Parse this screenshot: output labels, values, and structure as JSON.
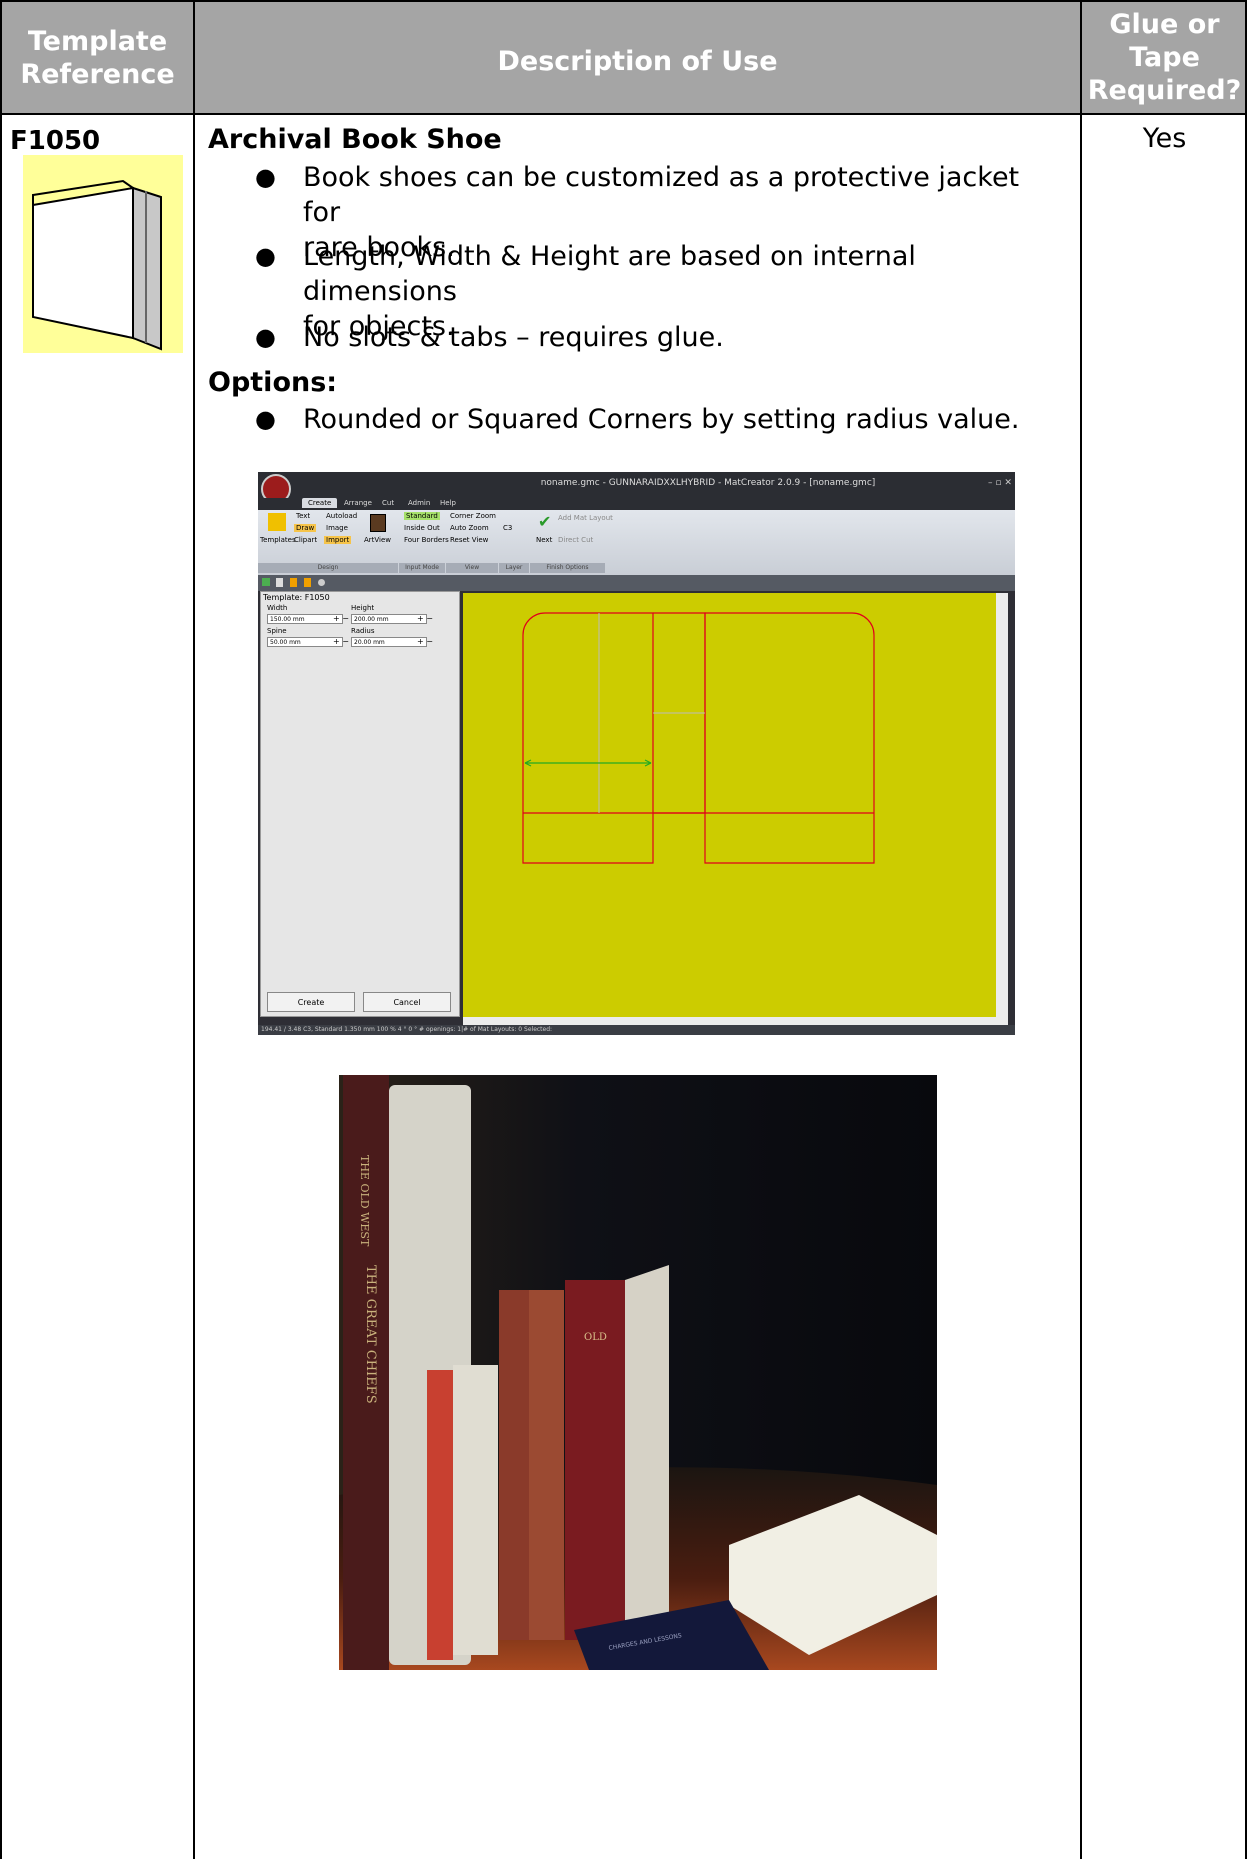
{
  "header": {
    "col1": "Template Reference",
    "col1_lines": [
      "Template",
      "Reference"
    ],
    "col2": "Description of Use",
    "col3_lines": [
      "Glue or",
      "Tape",
      "Required?"
    ]
  },
  "row": {
    "reference": "F1050",
    "glue_required": "Yes",
    "title": "Archival Book Shoe",
    "bullets": [
      [
        "Book shoes can be customized as a protective jacket for",
        "rare books."
      ],
      [
        "Length, Width & Height are based on internal dimensions",
        "for objects."
      ],
      [
        "No slots & tabs – requires glue."
      ]
    ],
    "options_label": "Options:",
    "options": [
      "Rounded or Squared Corners by setting radius value."
    ]
  },
  "screenshot": {
    "title": "noname.gmc - GUNNARAIDXXLHYBRID - MatCreator 2.0.9 - [noname.gmc]",
    "tabs": [
      "Create",
      "Arrange",
      "Cut",
      "Admin",
      "Help"
    ],
    "ribbon": {
      "templates": "Templates",
      "text": "Text",
      "autoload": "Autoload",
      "draw": "Draw",
      "image": "Image",
      "clipart": "Clipart",
      "import": "Import",
      "artview": "ArtView",
      "standard": "Standard",
      "inside_out": "Inside Out",
      "four_borders": "Four Borders",
      "corner_zoom": "Corner Zoom",
      "auto_zoom": "Auto Zoom",
      "reset_view": "Reset View",
      "c3": "C3",
      "next": "Next",
      "add_mat_layout": "Add Mat Layout",
      "direct_cut": "Direct Cut",
      "groups": [
        "Design",
        "Input Mode",
        "View",
        "Layer",
        "Finish Options"
      ]
    },
    "panel": {
      "template_label": "Template: F1050",
      "width_label": "Width",
      "width_value": "150.00 mm",
      "height_label": "Height",
      "height_value": "200.00 mm",
      "spine_label": "Spine",
      "spine_value": "50.00 mm",
      "radius_label": "Radius",
      "radius_value": "20.00 mm",
      "create": "Create",
      "cancel": "Cancel"
    },
    "status": "194.41 / 3.48      C3, Standard   1.350 mm   100 %   4 °   0 °   # openings:  1|# of Mat Layouts: 0   Selected:",
    "colors": {
      "canvas": "#cccc00",
      "outline": "#e0001a",
      "measure": "#22aa22"
    }
  },
  "photo": {
    "spine_text_1": "THE OLD WEST",
    "spine_text_2": "THE GREAT CHIEFS",
    "book_title": "OLD",
    "small_book_text": "CHARGES AND LESSONS"
  },
  "colors": {
    "header_bg": "#a5a5a5",
    "thumb_bg": "#ffff99"
  }
}
